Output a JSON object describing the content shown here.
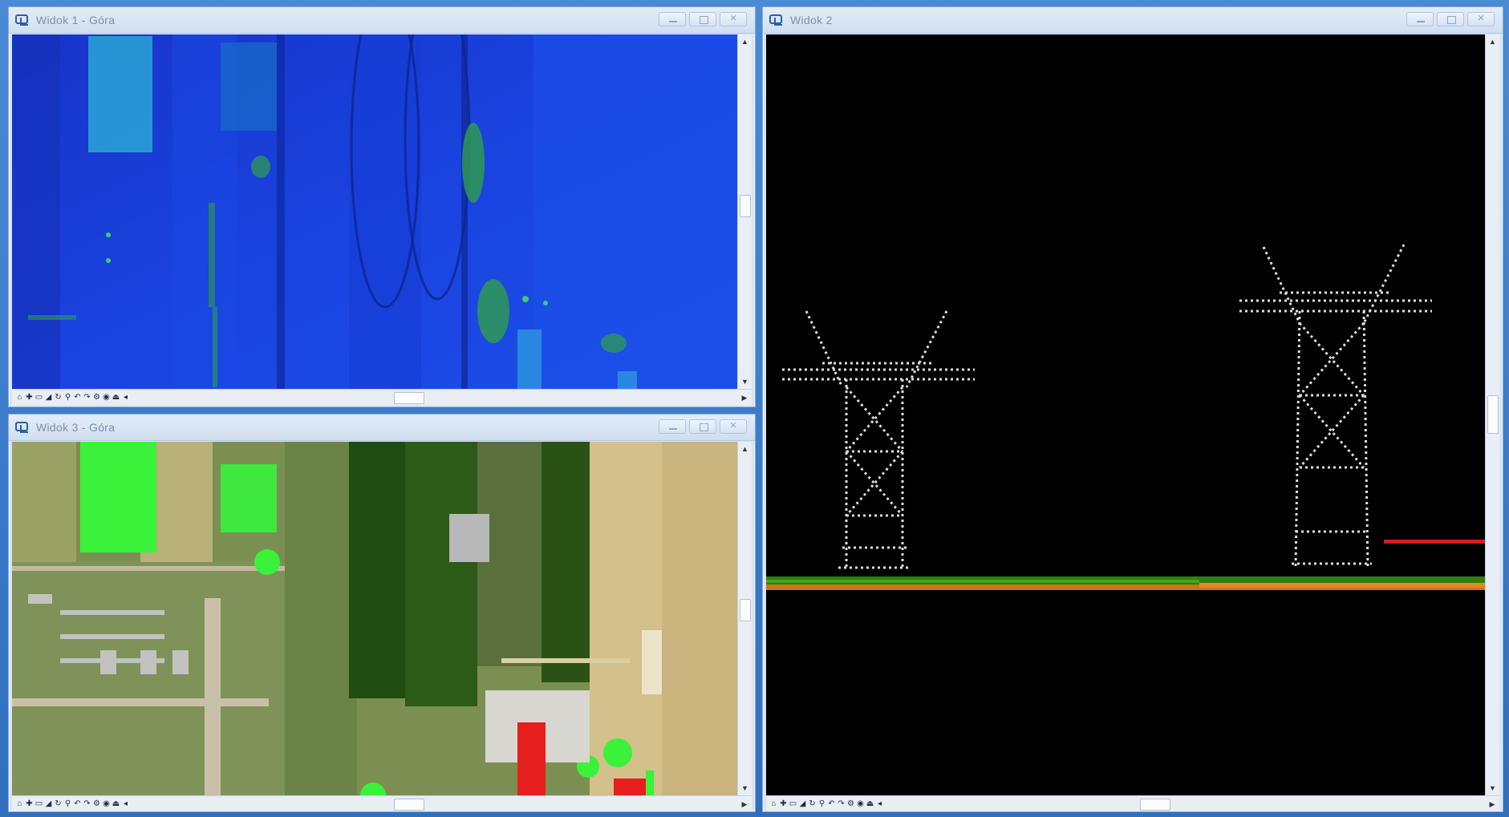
{
  "windows": {
    "top_left": {
      "title": "Widok 1 - Góra"
    },
    "bottom_left": {
      "title": "Widok 3 - Góra"
    },
    "right": {
      "title": "Widok 2"
    }
  },
  "toolbar": {
    "icons": [
      "home-icon",
      "pan-icon",
      "window-icon",
      "fit-icon",
      "rotate-icon",
      "zoom-icon",
      "undo-icon",
      "redo-icon",
      "settings-icon",
      "view-icon",
      "render-icon",
      "scroll-left-icon"
    ],
    "glyphs": [
      "⌂",
      "✚",
      "▭",
      "◢",
      "↻",
      "⚲",
      "↶",
      "↷",
      "⚙",
      "◉",
      "⏏",
      "◂"
    ]
  },
  "scroll": {
    "up": "▲",
    "down": "▼",
    "left": "◀",
    "right": "▶"
  },
  "colors": {
    "elevation_blue": "#1a3fd9",
    "ground_green": "#3a8f1c",
    "ground_orange": "#d67a1c",
    "wire_red": "#d81c1c",
    "point_white": "#e6e6e6",
    "classification_green": "#3bf23b",
    "classification_red": "#e81e1e"
  }
}
